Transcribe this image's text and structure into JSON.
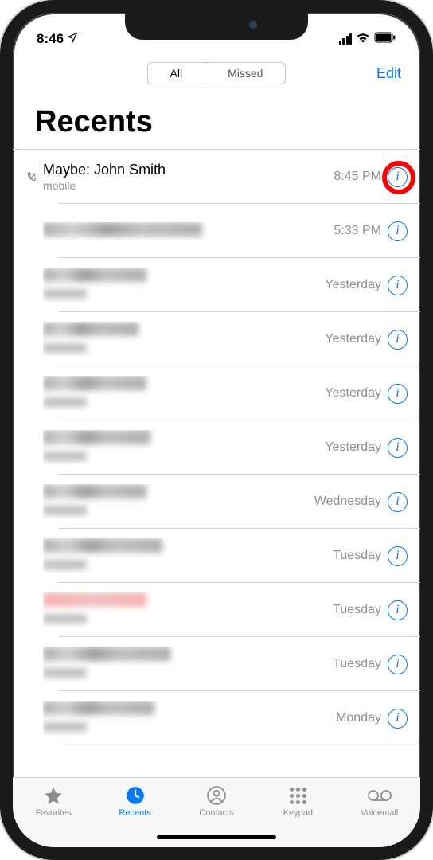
{
  "status": {
    "time": "8:46",
    "location": true
  },
  "nav": {
    "seg_all": "All",
    "seg_missed": "Missed",
    "edit": "Edit"
  },
  "title": "Recents",
  "calls": [
    {
      "name": "Maybe: John Smith",
      "sub": "mobile",
      "time": "8:45 PM",
      "outgoing": true,
      "highlighted": true
    },
    {
      "name": "",
      "sub": "",
      "time": "5:33 PM",
      "blurred": true,
      "name_w": 200,
      "sub_w": 0
    },
    {
      "name": "",
      "sub": "",
      "time": "Yesterday",
      "blurred": true,
      "name_w": 130,
      "sub_w": 55
    },
    {
      "name": "",
      "sub": "",
      "time": "Yesterday",
      "blurred": true,
      "name_w": 120,
      "sub_w": 55
    },
    {
      "name": "",
      "sub": "",
      "time": "Yesterday",
      "blurred": true,
      "name_w": 130,
      "sub_w": 55
    },
    {
      "name": "",
      "sub": "",
      "time": "Yesterday",
      "blurred": true,
      "name_w": 135,
      "sub_w": 55
    },
    {
      "name": "",
      "sub": "",
      "time": "Wednesday",
      "blurred": true,
      "name_w": 130,
      "sub_w": 55
    },
    {
      "name": "",
      "sub": "",
      "time": "Tuesday",
      "blurred": true,
      "name_w": 150,
      "sub_w": 55
    },
    {
      "name": "",
      "sub": "",
      "time": "Tuesday",
      "blurred": true,
      "name_w": 130,
      "sub_w": 55,
      "missed": true
    },
    {
      "name": "",
      "sub": "",
      "time": "Tuesday",
      "blurred": true,
      "name_w": 160,
      "sub_w": 55
    },
    {
      "name": "",
      "sub": "",
      "time": "Monday",
      "blurred": true,
      "name_w": 140,
      "sub_w": 55
    }
  ],
  "tabs": {
    "favorites": "Favorites",
    "recents": "Recents",
    "contacts": "Contacts",
    "keypad": "Keypad",
    "voicemail": "Voicemail"
  }
}
